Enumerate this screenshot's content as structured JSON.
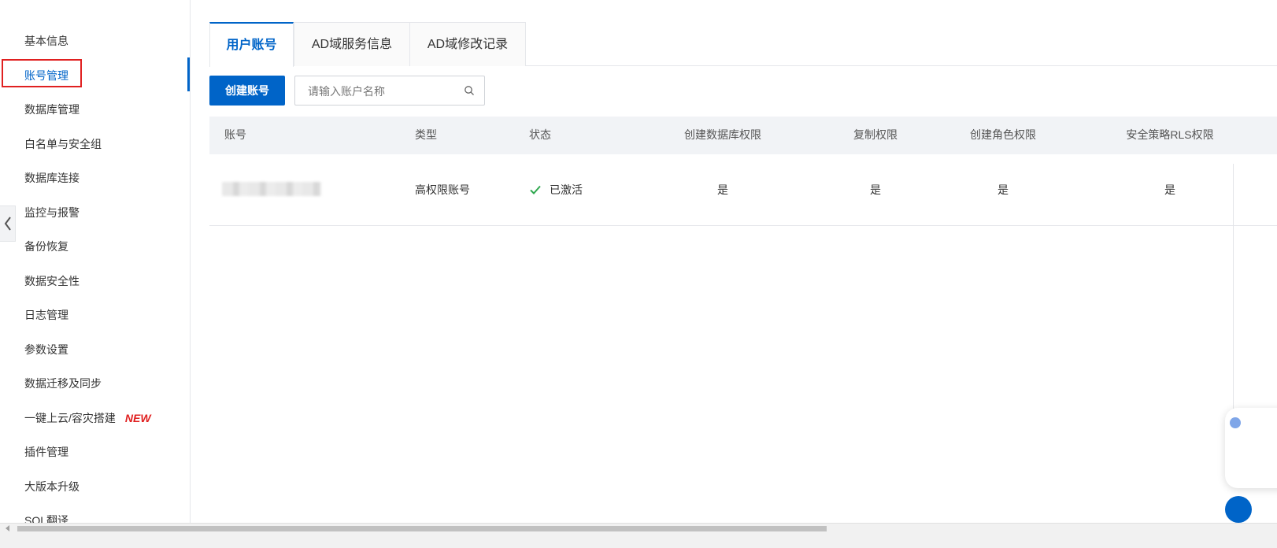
{
  "sidebar": {
    "items": [
      {
        "label": "基本信息"
      },
      {
        "label": "账号管理"
      },
      {
        "label": "数据库管理"
      },
      {
        "label": "白名单与安全组"
      },
      {
        "label": "数据库连接"
      },
      {
        "label": "监控与报警"
      },
      {
        "label": "备份恢复"
      },
      {
        "label": "数据安全性"
      },
      {
        "label": "日志管理"
      },
      {
        "label": "参数设置"
      },
      {
        "label": "数据迁移及同步"
      },
      {
        "label": "一键上云/容灾搭建",
        "badge": "NEW"
      },
      {
        "label": "插件管理"
      },
      {
        "label": "大版本升级"
      },
      {
        "label": "SQL翻译"
      }
    ],
    "active_label": "账号管理"
  },
  "tabs": [
    {
      "label": "用户账号",
      "active": true
    },
    {
      "label": "AD域服务信息",
      "active": false
    },
    {
      "label": "AD域修改记录",
      "active": false
    }
  ],
  "toolbar": {
    "create_label": "创建账号",
    "search_placeholder": "请输入账户名称"
  },
  "table": {
    "columns": [
      "账号",
      "类型",
      "状态",
      "创建数据库权限",
      "复制权限",
      "创建角色权限",
      "安全策略RLS权限"
    ],
    "rows": [
      {
        "account": "",
        "type": "高权限账号",
        "status": "已激活",
        "create_db": "是",
        "replication": "是",
        "create_role": "是",
        "rls": "是"
      }
    ]
  },
  "colors": {
    "accent": "#0064c8",
    "highlight_border": "#e02020",
    "new_badge": "#e02020",
    "status_ok": "#2fa84f"
  },
  "icons": {
    "search": "search-icon",
    "status": "check-icon",
    "collapse": "chevron-left-icon"
  }
}
